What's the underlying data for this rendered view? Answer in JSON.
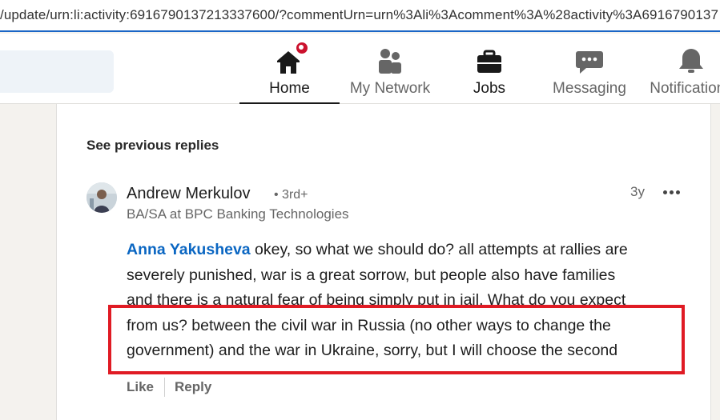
{
  "browser": {
    "url": "/update/urn:li:activity:6916790137213337600/?commentUrn=urn%3Ali%3Acomment%3A%28activity%3A6916790137"
  },
  "nav": {
    "items": [
      {
        "label": "Home",
        "icon": "home-icon",
        "active": true
      },
      {
        "label": "My Network",
        "icon": "my-network-icon"
      },
      {
        "label": "Jobs",
        "icon": "jobs-briefcase-icon"
      },
      {
        "label": "Messaging",
        "icon": "messaging-icon"
      },
      {
        "label": "Notifications",
        "icon": "bell-icon"
      }
    ]
  },
  "thread": {
    "see_previous": "See previous replies",
    "comment": {
      "author": "Andrew Merkulov",
      "degree": "• 3rd+",
      "headline": "BA/SA at BPC Banking Technologies",
      "time": "3y",
      "mention": "Anna Yakusheva",
      "line1_rest": " okey, so what we should do? all attempts at rallies are",
      "line2": "severely punished, war is a great sorrow, but people also have families",
      "line3": "and there is a natural fear of being simply put in jail. What do you expect",
      "line4": "from us? between the civil war in Russia (no other ways to change the",
      "line5": "government) and the war in Ukraine, sorry, but I will choose the second"
    },
    "actions": {
      "like": "Like",
      "reply": "Reply"
    }
  },
  "colors": {
    "link": "#0a66c2",
    "highlight_box": "#e01b24",
    "notification_badge": "#cb112d"
  }
}
